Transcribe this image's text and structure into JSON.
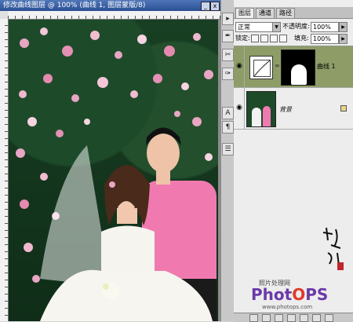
{
  "document": {
    "title": "修改曲线图层 @ 100% (曲线 1, 图层蒙版/8)",
    "close_label": "x"
  },
  "toolbox": {
    "icons": [
      "arrow-icon",
      "brush-icon",
      "crop-icon",
      "pen-icon",
      "text-icon",
      "note-icon",
      "hand-icon",
      "zoom-icon"
    ]
  },
  "panel": {
    "tabs": [
      {
        "label": "图层"
      },
      {
        "label": "通道"
      },
      {
        "label": "路径"
      }
    ],
    "blend_mode": "正常",
    "opacity_label": "不透明度:",
    "opacity_value": "100%",
    "lock_label": "锁定:",
    "fill_label": "填充:",
    "fill_value": "100%",
    "layers": [
      {
        "name": "曲线 1",
        "type": "adjustment",
        "selected": true
      },
      {
        "name": "背景",
        "type": "background",
        "selected": false
      }
    ]
  },
  "watermark": {
    "caption": "照片处理网",
    "brand_a": "Phot",
    "brand_o": "O",
    "brand_b": "PS",
    "url": "www.photops.com"
  },
  "colors": {
    "title_bar": "#2b4f94",
    "layer_selected": "#8e9d68",
    "brand_purple": "#6a3aa8",
    "brand_red": "#e03a2a"
  }
}
